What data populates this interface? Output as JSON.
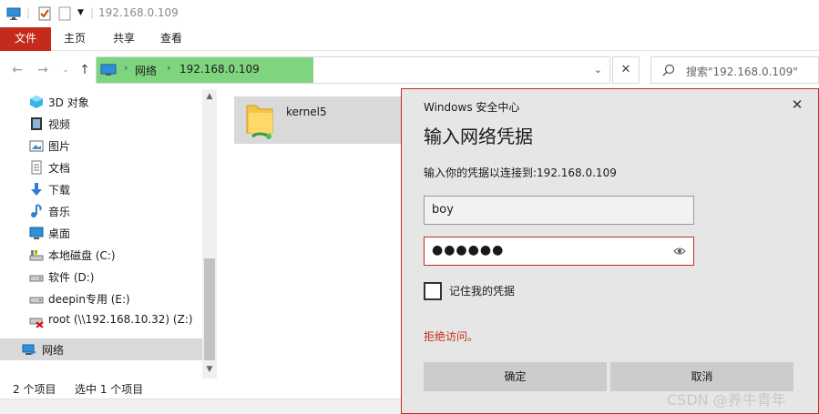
{
  "titlebar": {
    "path_title": "192.168.0.109"
  },
  "ribbon": {
    "tabs": [
      "文件",
      "主页",
      "共享",
      "查看"
    ]
  },
  "address": {
    "segment_network": "网络",
    "segment_ip": "192.168.0.109"
  },
  "search": {
    "placeholder": "搜索\"192.168.0.109\""
  },
  "sidebar": {
    "items": [
      {
        "label": "3D 对象",
        "icon": "cube-3d-icon"
      },
      {
        "label": "视频",
        "icon": "video-icon"
      },
      {
        "label": "图片",
        "icon": "pictures-icon"
      },
      {
        "label": "文档",
        "icon": "documents-icon"
      },
      {
        "label": "下载",
        "icon": "download-icon"
      },
      {
        "label": "音乐",
        "icon": "music-icon"
      },
      {
        "label": "桌面",
        "icon": "desktop-icon"
      },
      {
        "label": "本地磁盘 (C:)",
        "icon": "drive-c-icon"
      },
      {
        "label": "软件 (D:)",
        "icon": "drive-icon"
      },
      {
        "label": "deepin专用 (E:)",
        "icon": "drive-icon"
      },
      {
        "label": "root (\\\\192.168.10.32) (Z:)",
        "icon": "disconnected-drive-icon"
      },
      {
        "label": "网络",
        "icon": "network-icon"
      }
    ]
  },
  "files": [
    {
      "name": "kernel5",
      "icon": "shared-folder-icon"
    }
  ],
  "status": {
    "count": "2 个项目",
    "selected": "选中 1 个项目"
  },
  "dialog": {
    "app_name": "Windows 安全中心",
    "title": "输入网络凭据",
    "prompt": "输入你的凭据以连接到:192.168.0.109",
    "username": "boy",
    "password_mask": "●●●●●●",
    "remember_label": "记住我的凭据",
    "error": "拒绝访问。",
    "ok": "确定",
    "cancel": "取消"
  },
  "watermark": "CSDN @养牛青年",
  "colors": {
    "accent_red": "#c42b1c",
    "address_green": "#7fd47f",
    "selection_gray": "#d9d9d9"
  }
}
